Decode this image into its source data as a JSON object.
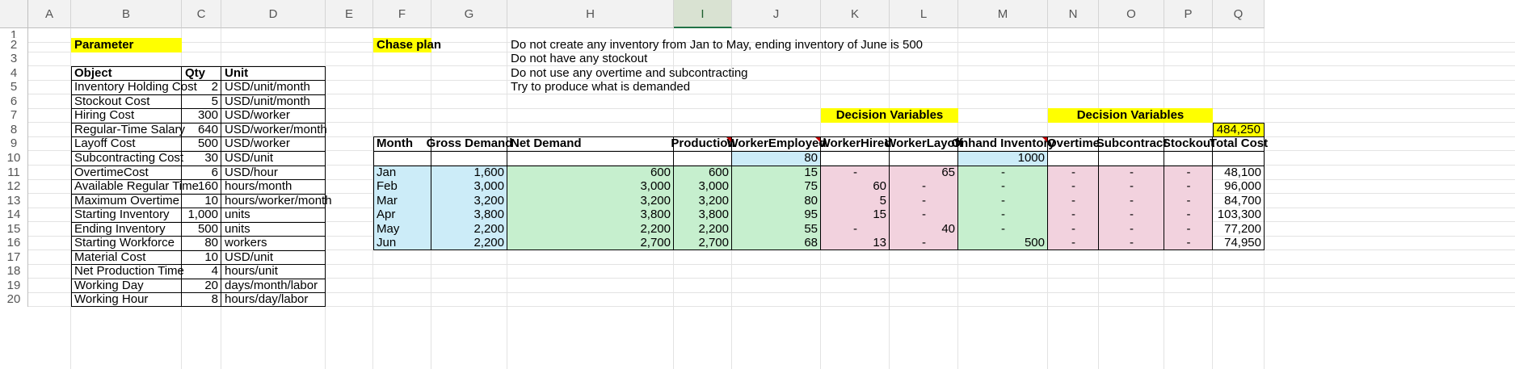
{
  "columns": [
    "A",
    "B",
    "C",
    "D",
    "E",
    "F",
    "G",
    "H",
    "I",
    "J",
    "K",
    "L",
    "M",
    "N",
    "O",
    "P",
    "Q"
  ],
  "rows": [
    "1",
    "2",
    "3",
    "4",
    "5",
    "6",
    "7",
    "8",
    "9",
    "10",
    "11",
    "12",
    "13",
    "14",
    "15",
    "16",
    "17",
    "18",
    "19",
    "20"
  ],
  "parameter": {
    "title": "Parameter",
    "headers": [
      "Object",
      "Qty",
      "Unit"
    ],
    "items": [
      {
        "object": "Inventory Holding Cost",
        "qty": "2",
        "unit": "USD/unit/month"
      },
      {
        "object": "Stockout Cost",
        "qty": "5",
        "unit": "USD/unit/month"
      },
      {
        "object": "Hiring Cost",
        "qty": "300",
        "unit": "USD/worker"
      },
      {
        "object": "Regular-Time Salary",
        "qty": "640",
        "unit": "USD/worker/month"
      },
      {
        "object": "Layoff Cost",
        "qty": "500",
        "unit": "USD/worker"
      },
      {
        "object": "Subcontracting Cost",
        "qty": "30",
        "unit": "USD/unit"
      },
      {
        "object": "OvertimeCost",
        "qty": "6",
        "unit": "USD/hour"
      },
      {
        "object": "Available Regular Time",
        "qty": "160",
        "unit": "hours/month"
      },
      {
        "object": "Maximum Overtime",
        "qty": "10",
        "unit": "hours/worker/month"
      },
      {
        "object": "Starting Inventory",
        "qty": "1,000",
        "unit": "units"
      },
      {
        "object": "Ending Inventory",
        "qty": "500",
        "unit": "units"
      },
      {
        "object": "Starting Workforce",
        "qty": "80",
        "unit": "workers"
      },
      {
        "object": "Material Cost",
        "qty": "10",
        "unit": "USD/unit"
      },
      {
        "object": "Net Production Time",
        "qty": "4",
        "unit": "hours/unit"
      },
      {
        "object": "Working Day",
        "qty": "20",
        "unit": "days/month/labor"
      },
      {
        "object": "Working Hour",
        "qty": "8",
        "unit": "hours/day/labor"
      }
    ]
  },
  "chase": {
    "title": "Chase plan",
    "notes": [
      "Do not create any inventory from Jan to May, ending inventory of June is 500",
      "Do not have any stockout",
      "Do not use any overtime and subcontracting",
      "Try to produce what is demanded"
    ],
    "decision_label_1": "Decision Variables",
    "decision_label_2": "Decision Variables",
    "total": "484,250",
    "headers": [
      "Month",
      "Gross Demand",
      "Net Demand",
      "Production",
      "WorkerEmployed",
      "WorkerHired",
      "WorkerLayoff",
      "Onhand Inventory",
      "Overtime",
      "Subcontract",
      "Stockout",
      "Total Cost"
    ],
    "initial_workers": "80",
    "initial_inventory": "1000",
    "rows": [
      [
        "Jan",
        "1,600",
        "600",
        "600",
        "15",
        "-",
        "65",
        "-",
        "-",
        "-",
        "-",
        "48,100"
      ],
      [
        "Feb",
        "3,000",
        "3,000",
        "3,000",
        "75",
        "60",
        "-",
        "-",
        "-",
        "-",
        "-",
        "96,000"
      ],
      [
        "Mar",
        "3,200",
        "3,200",
        "3,200",
        "80",
        "5",
        "-",
        "-",
        "-",
        "-",
        "-",
        "84,700"
      ],
      [
        "Apr",
        "3,800",
        "3,800",
        "3,800",
        "95",
        "15",
        "-",
        "-",
        "-",
        "-",
        "-",
        "103,300"
      ],
      [
        "May",
        "2,200",
        "2,200",
        "2,200",
        "55",
        "-",
        "40",
        "-",
        "-",
        "-",
        "-",
        "77,200"
      ],
      [
        "Jun",
        "2,200",
        "2,700",
        "2,700",
        "68",
        "13",
        "-",
        "500",
        "-",
        "-",
        "-",
        "74,950"
      ]
    ]
  }
}
